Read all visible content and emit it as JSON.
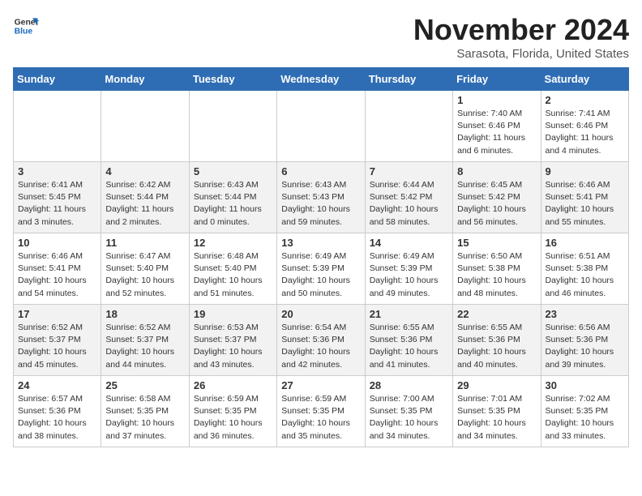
{
  "logo": {
    "text_general": "General",
    "text_blue": "Blue"
  },
  "title": "November 2024",
  "location": "Sarasota, Florida, United States",
  "days_of_week": [
    "Sunday",
    "Monday",
    "Tuesday",
    "Wednesday",
    "Thursday",
    "Friday",
    "Saturday"
  ],
  "weeks": [
    [
      {
        "day": "",
        "info": ""
      },
      {
        "day": "",
        "info": ""
      },
      {
        "day": "",
        "info": ""
      },
      {
        "day": "",
        "info": ""
      },
      {
        "day": "",
        "info": ""
      },
      {
        "day": "1",
        "info": "Sunrise: 7:40 AM\nSunset: 6:46 PM\nDaylight: 11 hours\nand 6 minutes."
      },
      {
        "day": "2",
        "info": "Sunrise: 7:41 AM\nSunset: 6:46 PM\nDaylight: 11 hours\nand 4 minutes."
      }
    ],
    [
      {
        "day": "3",
        "info": "Sunrise: 6:41 AM\nSunset: 5:45 PM\nDaylight: 11 hours\nand 3 minutes."
      },
      {
        "day": "4",
        "info": "Sunrise: 6:42 AM\nSunset: 5:44 PM\nDaylight: 11 hours\nand 2 minutes."
      },
      {
        "day": "5",
        "info": "Sunrise: 6:43 AM\nSunset: 5:44 PM\nDaylight: 11 hours\nand 0 minutes."
      },
      {
        "day": "6",
        "info": "Sunrise: 6:43 AM\nSunset: 5:43 PM\nDaylight: 10 hours\nand 59 minutes."
      },
      {
        "day": "7",
        "info": "Sunrise: 6:44 AM\nSunset: 5:42 PM\nDaylight: 10 hours\nand 58 minutes."
      },
      {
        "day": "8",
        "info": "Sunrise: 6:45 AM\nSunset: 5:42 PM\nDaylight: 10 hours\nand 56 minutes."
      },
      {
        "day": "9",
        "info": "Sunrise: 6:46 AM\nSunset: 5:41 PM\nDaylight: 10 hours\nand 55 minutes."
      }
    ],
    [
      {
        "day": "10",
        "info": "Sunrise: 6:46 AM\nSunset: 5:41 PM\nDaylight: 10 hours\nand 54 minutes."
      },
      {
        "day": "11",
        "info": "Sunrise: 6:47 AM\nSunset: 5:40 PM\nDaylight: 10 hours\nand 52 minutes."
      },
      {
        "day": "12",
        "info": "Sunrise: 6:48 AM\nSunset: 5:40 PM\nDaylight: 10 hours\nand 51 minutes."
      },
      {
        "day": "13",
        "info": "Sunrise: 6:49 AM\nSunset: 5:39 PM\nDaylight: 10 hours\nand 50 minutes."
      },
      {
        "day": "14",
        "info": "Sunrise: 6:49 AM\nSunset: 5:39 PM\nDaylight: 10 hours\nand 49 minutes."
      },
      {
        "day": "15",
        "info": "Sunrise: 6:50 AM\nSunset: 5:38 PM\nDaylight: 10 hours\nand 48 minutes."
      },
      {
        "day": "16",
        "info": "Sunrise: 6:51 AM\nSunset: 5:38 PM\nDaylight: 10 hours\nand 46 minutes."
      }
    ],
    [
      {
        "day": "17",
        "info": "Sunrise: 6:52 AM\nSunset: 5:37 PM\nDaylight: 10 hours\nand 45 minutes."
      },
      {
        "day": "18",
        "info": "Sunrise: 6:52 AM\nSunset: 5:37 PM\nDaylight: 10 hours\nand 44 minutes."
      },
      {
        "day": "19",
        "info": "Sunrise: 6:53 AM\nSunset: 5:37 PM\nDaylight: 10 hours\nand 43 minutes."
      },
      {
        "day": "20",
        "info": "Sunrise: 6:54 AM\nSunset: 5:36 PM\nDaylight: 10 hours\nand 42 minutes."
      },
      {
        "day": "21",
        "info": "Sunrise: 6:55 AM\nSunset: 5:36 PM\nDaylight: 10 hours\nand 41 minutes."
      },
      {
        "day": "22",
        "info": "Sunrise: 6:55 AM\nSunset: 5:36 PM\nDaylight: 10 hours\nand 40 minutes."
      },
      {
        "day": "23",
        "info": "Sunrise: 6:56 AM\nSunset: 5:36 PM\nDaylight: 10 hours\nand 39 minutes."
      }
    ],
    [
      {
        "day": "24",
        "info": "Sunrise: 6:57 AM\nSunset: 5:36 PM\nDaylight: 10 hours\nand 38 minutes."
      },
      {
        "day": "25",
        "info": "Sunrise: 6:58 AM\nSunset: 5:35 PM\nDaylight: 10 hours\nand 37 minutes."
      },
      {
        "day": "26",
        "info": "Sunrise: 6:59 AM\nSunset: 5:35 PM\nDaylight: 10 hours\nand 36 minutes."
      },
      {
        "day": "27",
        "info": "Sunrise: 6:59 AM\nSunset: 5:35 PM\nDaylight: 10 hours\nand 35 minutes."
      },
      {
        "day": "28",
        "info": "Sunrise: 7:00 AM\nSunset: 5:35 PM\nDaylight: 10 hours\nand 34 minutes."
      },
      {
        "day": "29",
        "info": "Sunrise: 7:01 AM\nSunset: 5:35 PM\nDaylight: 10 hours\nand 34 minutes."
      },
      {
        "day": "30",
        "info": "Sunrise: 7:02 AM\nSunset: 5:35 PM\nDaylight: 10 hours\nand 33 minutes."
      }
    ]
  ]
}
